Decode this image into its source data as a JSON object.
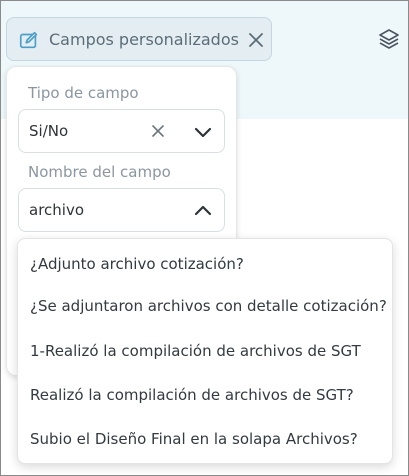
{
  "filter_chip": {
    "label": "Campos personalizados",
    "icon": "edit-field-icon",
    "close_icon": "close-icon"
  },
  "toolbar": {
    "layers_icon": "layers-icon"
  },
  "field_type": {
    "label": "Tipo de campo",
    "value": "Si/No"
  },
  "field_name": {
    "label": "Nombre del campo",
    "value": "archivo"
  },
  "options": [
    "¿Adjunto archivo cotización?",
    "¿Se adjuntaron archivos con detalle cotización?",
    "1-Realizó la compilación de archivos de SGT",
    "Realizó la compilación de archivos de SGT?",
    "Subio el Diseño Final en la solapa Archivos?"
  ],
  "colors": {
    "accent": "#4a9fc9",
    "chip_bg": "#e4eef2",
    "band_bg": "#eef8fa"
  }
}
